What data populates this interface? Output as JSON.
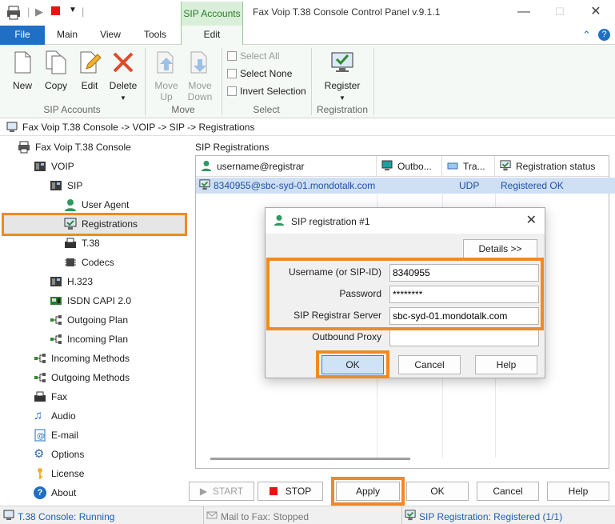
{
  "window": {
    "title": "Fax Voip T.38 Console Control Panel v.9.1.1",
    "context_tab": "SIP Accounts"
  },
  "tabs": {
    "file": "File",
    "main": "Main",
    "view": "View",
    "tools": "Tools",
    "edit": "Edit"
  },
  "ribbon": {
    "groups": {
      "sip_accounts": "SIP Accounts",
      "move": "Move",
      "select": "Select",
      "registration": "Registration"
    },
    "new": "New",
    "copy": "Copy",
    "edit": "Edit",
    "delete": "Delete",
    "move_up": "Move Up",
    "move_down": "Move Down",
    "select_all": "Select All",
    "select_none": "Select None",
    "invert_selection": "Invert Selection",
    "register": "Register",
    "accent": "#f08a24"
  },
  "breadcrumb": "Fax Voip T.38 Console -> VOIP -> SIP -> Registrations",
  "tree": {
    "root": "Fax Voip T.38 Console",
    "voip": "VOIP",
    "sip": "SIP",
    "user_agent": "User Agent",
    "registrations": "Registrations",
    "t38": "T.38",
    "codecs": "Codecs",
    "h323": "H.323",
    "isdn": "ISDN CAPI 2.0",
    "outgoing_plan": "Outgoing Plan",
    "incoming_plan": "Incoming Plan",
    "incoming_methods": "Incoming Methods",
    "outgoing_methods": "Outgoing Methods",
    "fax": "Fax",
    "audio": "Audio",
    "email": "E-mail",
    "options": "Options",
    "license": "License",
    "about": "About"
  },
  "panel": {
    "title": "SIP Registrations",
    "columns": {
      "user": "username@registrar",
      "outbound": "Outbo...",
      "transport": "Tra...",
      "status": "Registration status"
    },
    "rows": [
      {
        "user": "8340955@sbc-syd-01.mondotalk.com",
        "transport": "UDP",
        "status": "Registered OK"
      }
    ]
  },
  "dialog": {
    "title": "SIP registration #1",
    "details": "Details >>",
    "username_label": "Username (or SIP-ID)",
    "username_value": "8340955",
    "password_label": "Password",
    "password_value": "********",
    "registrar_label": "SIP Registrar Server",
    "registrar_value": "sbc-syd-01.mondotalk.com",
    "proxy_label": "Outbound Proxy",
    "proxy_value": "",
    "ok": "OK",
    "cancel": "Cancel",
    "help": "Help"
  },
  "buttons": {
    "start": "START",
    "stop": "STOP",
    "apply": "Apply",
    "ok": "OK",
    "cancel": "Cancel",
    "help": "Help"
  },
  "status": {
    "t38": "T.38 Console: Running",
    "mail": "Mail to Fax: Stopped",
    "sip": "SIP Registration: Registered (1/1)"
  }
}
